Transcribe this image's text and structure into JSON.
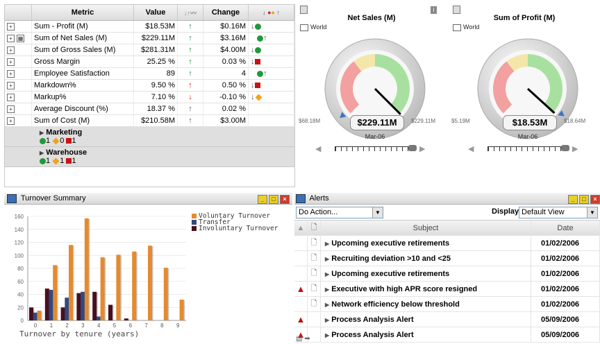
{
  "kpi": {
    "headers": {
      "metric": "Metric",
      "value": "Value",
      "change": "Change"
    },
    "rows": [
      {
        "metric": "Sum - Profit (M)",
        "value": "$18.53M",
        "trend": "up",
        "change": "$0.16M",
        "status": "down-green"
      },
      {
        "metric": "Sum of Net Sales (M)",
        "value": "$229.11M",
        "trend": "up",
        "change": "$3.16M",
        "status": "green-up"
      },
      {
        "metric": "Sum of Gross Sales (M)",
        "value": "$281.31M",
        "trend": "up",
        "change": "$4.00M",
        "status": "down-green"
      },
      {
        "metric": "Gross Margin",
        "value": "25.25 %",
        "trend": "up",
        "change": "0.03 %",
        "status": "down-red"
      },
      {
        "metric": "Employee Satisfaction",
        "value": "89",
        "trend": "up",
        "change": "4",
        "status": "green-up"
      },
      {
        "metric": "Markdown%",
        "value": "9.50 %",
        "trend": "up-red",
        "change": "0.50 %",
        "status": "down-red"
      },
      {
        "metric": "Markup%",
        "value": "7.10 %",
        "trend": "down-red",
        "change": "-0.10 %",
        "status": "down-orange"
      },
      {
        "metric": "Average Discount (%)",
        "value": "18.37 %",
        "trend": "thin-up",
        "change": "0.02 %",
        "status": ""
      },
      {
        "metric": "Sum of Cost (M)",
        "value": "$210.58M",
        "trend": "thin-up",
        "change": "$3.00M",
        "status": ""
      }
    ],
    "groups": [
      {
        "name": "Marketing",
        "green": "1",
        "orange": "0",
        "red": "1"
      },
      {
        "name": "Warehouse",
        "green": "1",
        "orange": "1",
        "red": "1"
      }
    ]
  },
  "gauges": [
    {
      "title": "Net Sales (M)",
      "scope": "World",
      "value": "$229.11M",
      "min": "$68.18M",
      "max": "$229.11M",
      "period": "Mar-06",
      "needle": 1.0
    },
    {
      "title": "Sum of Profit (M)",
      "scope": "World",
      "value": "$18.53M",
      "min": "$5.19M",
      "max": "$18.64M",
      "period": "Mar-06",
      "needle": 0.99
    }
  ],
  "turnover": {
    "title": "Turnover Summary",
    "chart_data": {
      "type": "bar",
      "categories": [
        "0",
        "1",
        "2",
        "3",
        "4",
        "5",
        "6",
        "7",
        "8",
        "9"
      ],
      "series": [
        {
          "name": "Voluntary Turnover",
          "color": "#e58a2e",
          "values": [
            15,
            85,
            116,
            157,
            97,
            101,
            106,
            115,
            81,
            32
          ]
        },
        {
          "name": "Transfer",
          "color": "#2e4a86",
          "values": [
            12,
            47,
            35,
            44,
            6,
            0,
            0,
            0,
            0,
            0
          ]
        },
        {
          "name": "Involuntary Turnover",
          "color": "#4a0f1e",
          "values": [
            20,
            49,
            20,
            42,
            44,
            24,
            3,
            0,
            0,
            0
          ]
        }
      ],
      "xlabel": "Turnover by tenure (years)",
      "ylim": [
        0,
        160
      ],
      "yticks": [
        "0",
        "20",
        "40",
        "60",
        "80",
        "100",
        "120",
        "140",
        "160"
      ]
    }
  },
  "alerts": {
    "title": "Alerts",
    "action_select": "Do Action...",
    "display_label": "Display:",
    "display_select": "Default View",
    "col_subject": "Subject",
    "col_date": "Date",
    "rows": [
      {
        "severity": "",
        "doc": true,
        "subject": "Upcoming executive retirements",
        "date": "01/02/2006"
      },
      {
        "severity": "",
        "doc": true,
        "subject": "Recruiting deviation >10 and <25",
        "date": "01/02/2006"
      },
      {
        "severity": "",
        "doc": true,
        "subject": "Upcoming executive retirements",
        "date": "01/02/2006"
      },
      {
        "severity": "warning",
        "doc": true,
        "subject": "Executive with high APR score resigned",
        "date": "01/02/2006"
      },
      {
        "severity": "",
        "doc": true,
        "subject": "Network efficiency below threshold",
        "date": "01/02/2006"
      },
      {
        "severity": "warning",
        "doc": false,
        "subject": "Process Analysis Alert",
        "date": "05/09/2006"
      },
      {
        "severity": "warning",
        "doc": false,
        "subject": "Process Analysis Alert",
        "date": "05/09/2006"
      }
    ]
  }
}
